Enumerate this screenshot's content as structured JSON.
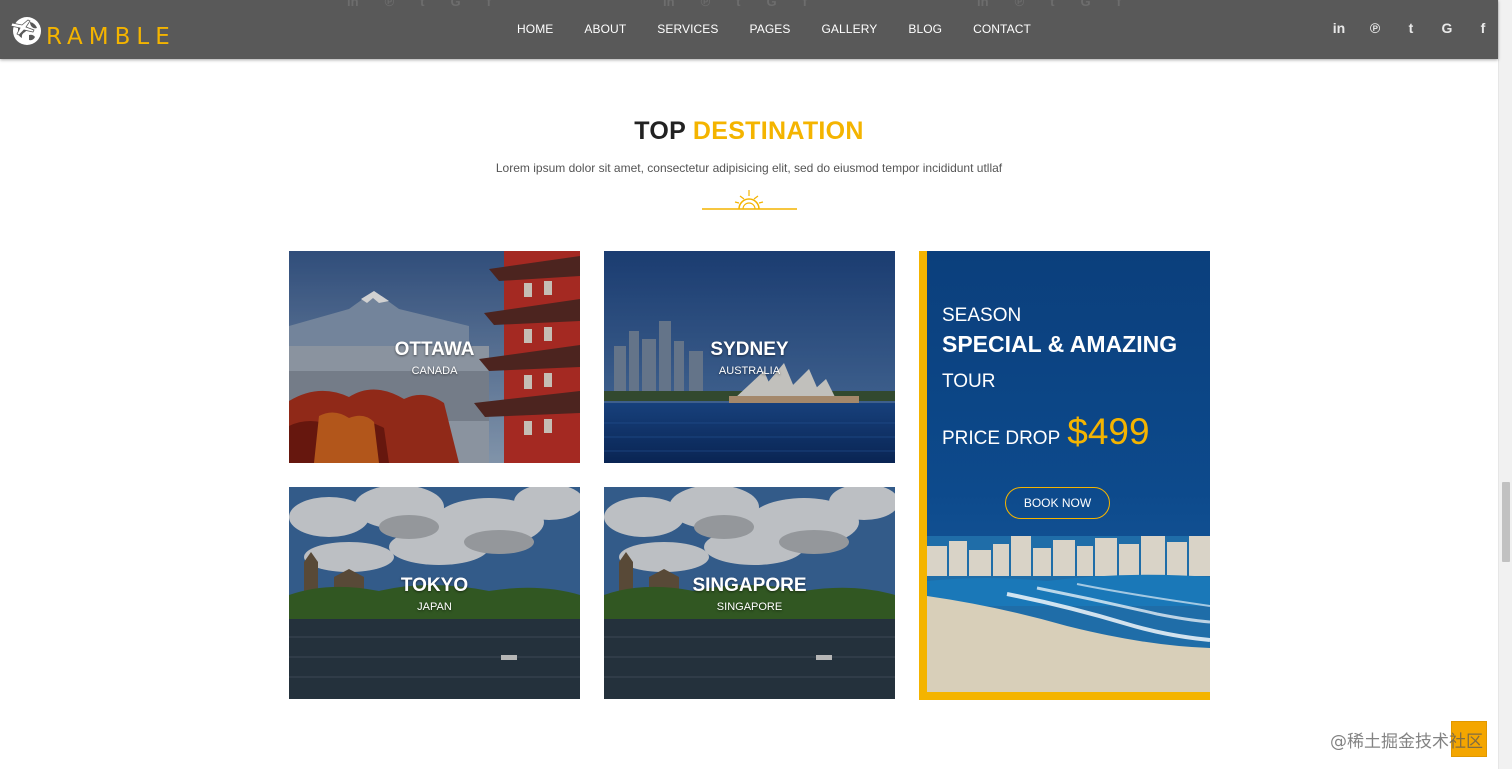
{
  "header": {
    "logo_text": "RAMBLE",
    "nav": [
      {
        "label": "HOME"
      },
      {
        "label": "ABOUT"
      },
      {
        "label": "SERVICES"
      },
      {
        "label": "PAGES"
      },
      {
        "label": "GALLERY"
      },
      {
        "label": "BLOG"
      },
      {
        "label": "CONTACT"
      }
    ],
    "social": [
      {
        "icon": "linkedin-icon",
        "glyph": "in"
      },
      {
        "icon": "pinterest-icon",
        "glyph": "℗"
      },
      {
        "icon": "tumblr-icon",
        "glyph": "t"
      },
      {
        "icon": "google-icon",
        "glyph": "G"
      },
      {
        "icon": "facebook-icon",
        "glyph": "f"
      }
    ]
  },
  "section": {
    "title_part1": "TOP",
    "title_part2": "DESTINATION",
    "subtitle": "Lorem ipsum dolor sit amet, consectetur adipisicing elit, sed do eiusmod tempor incididunt utllaf"
  },
  "destinations": [
    {
      "city": "OTTAWA",
      "country": "CANADA"
    },
    {
      "city": "SYDNEY",
      "country": "AUSTRALIA"
    },
    {
      "city": "TOKYO",
      "country": "JAPAN"
    },
    {
      "city": "SINGAPORE",
      "country": "SINGAPORE"
    }
  ],
  "promo": {
    "line1": "SEASON",
    "line2": "SPECIAL & AMAZING",
    "line3": "TOUR",
    "price_label": "PRICE DROP",
    "price": "$499",
    "button": "BOOK NOW"
  },
  "watermark": "@稀土掘金技术社区",
  "colors": {
    "accent": "#f4b400",
    "header_bg": "#595959",
    "promo_bg": "#0d4a8c"
  }
}
